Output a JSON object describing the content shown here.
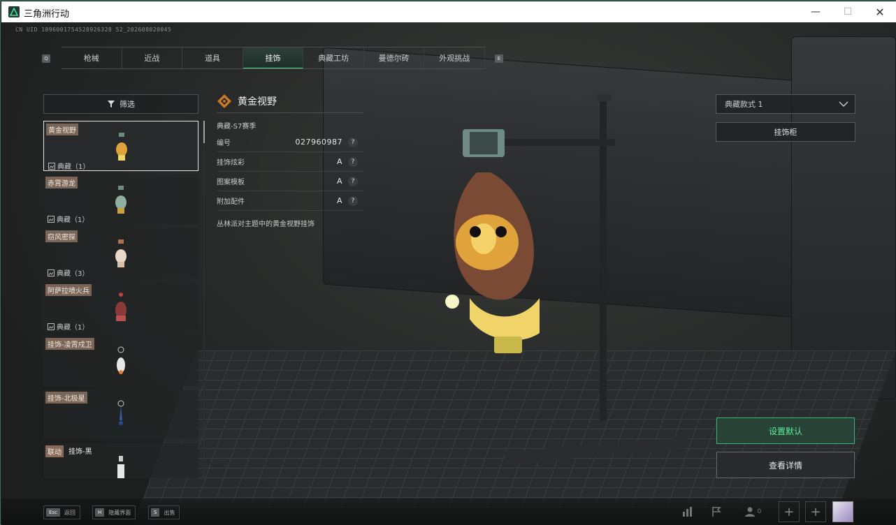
{
  "window": {
    "title": "三角洲行动"
  },
  "uid": "CN UID 1896001754528926328 52_202608020045",
  "tabs": [
    "枪械",
    "近战",
    "道具",
    "挂饰",
    "典藏工坊",
    "曼德尔砖",
    "外观挑战"
  ],
  "tab_keys": {
    "left": "Q",
    "right": "E"
  },
  "filter": {
    "label": "筛选"
  },
  "items": [
    {
      "name": "黄金视野",
      "count": "典藏（1）",
      "selected": true
    },
    {
      "name": "赤霄游龙",
      "count": "典藏（1）"
    },
    {
      "name": "窃风密探",
      "count": "典藏（3）"
    },
    {
      "name": "阿萨拉喷火兵",
      "count": "典藏（1）"
    },
    {
      "name": "挂饰-凌霄戍卫",
      "count": ""
    },
    {
      "name": "挂饰-北极星",
      "count": ""
    },
    {
      "name": "联动",
      "name2": "挂饰-黑",
      "count": ""
    }
  ],
  "detail": {
    "title": "黄金视野",
    "season": "典藏-S7赛季",
    "rows": [
      {
        "label": "编号",
        "value": "027960987"
      },
      {
        "label": "挂饰炫彩",
        "value": "A"
      },
      {
        "label": "图案模板",
        "value": "A"
      },
      {
        "label": "附加配件",
        "value": "A"
      }
    ],
    "desc": "丛林派对主题中的黄金视野挂饰"
  },
  "style_dropdown": "典藏款式 1",
  "cabinet_button": "挂饰柜",
  "set_default": "设置默认",
  "view_details": "查看详情",
  "bottom": {
    "esc": {
      "key": "Esc",
      "label": "返回"
    },
    "h": {
      "key": "H",
      "label": "隐藏界面"
    },
    "s": {
      "key": "S",
      "label": "出售"
    },
    "friend_count": "0"
  },
  "colors": {
    "accent": "#4fdc9a",
    "selected_border": "#e6e6e6",
    "name_tag": "#7a6658"
  }
}
